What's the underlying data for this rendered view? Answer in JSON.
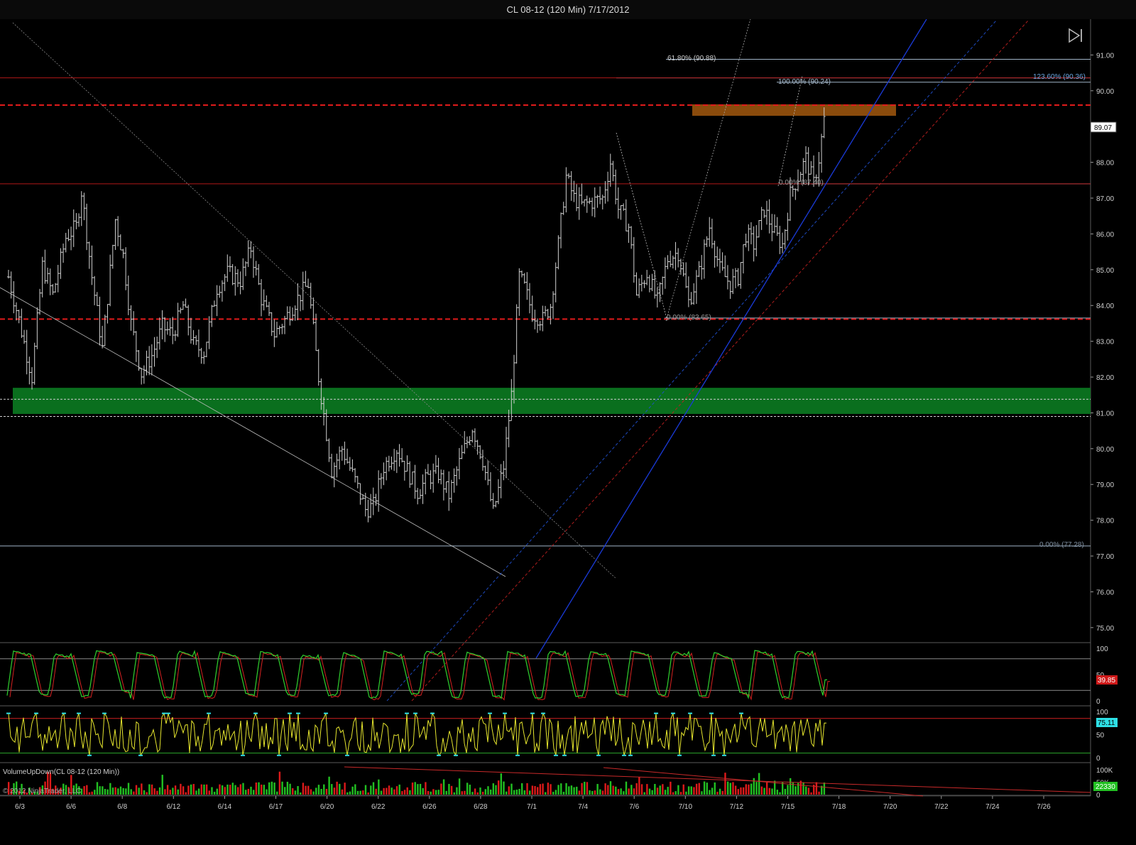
{
  "window": {
    "title": "CL 08-12 (120 Min)  7/17/2012",
    "corner_button": "F"
  },
  "colors": {
    "background": "#000000",
    "bars": "#d0d0d0",
    "support_zone": "#0a6f1e",
    "resistance_zone": "#8a4b0c",
    "red_dashed": "#e01b1b",
    "fib_line": "#a0b4c8",
    "stoch_k": "#2ed12e",
    "stoch_d": "#d62020",
    "rsi_line": "#e6e62e",
    "rsi_extreme": "#2ee0e6",
    "volume_up": "#22c022",
    "volume_down": "#dd1a1a"
  },
  "chart_data": [
    {
      "type": "ohlc",
      "instrument": "CL 08-12",
      "interval": "120 Min",
      "ylim": [
        74.6,
        92.0
      ],
      "y_ticks": [
        "91.00",
        "90.00",
        "89.00",
        "88.00",
        "87.00",
        "86.00",
        "85.00",
        "84.00",
        "83.00",
        "82.00",
        "81.00",
        "80.00",
        "79.00",
        "78.00",
        "77.00",
        "76.00",
        "75.00"
      ],
      "last_price": "89.07",
      "x_ticks": [
        "6/3",
        "6/6",
        "6/8",
        "6/12",
        "6/14",
        "6/17",
        "6/20",
        "6/22",
        "6/26",
        "6/28",
        "7/1",
        "7/4",
        "7/6",
        "7/10",
        "7/12",
        "7/15",
        "7/18",
        "7/20",
        "7/22",
        "7/24",
        "7/26"
      ],
      "close_path": [
        [
          0,
          84.8
        ],
        [
          4,
          83.6
        ],
        [
          9,
          82.0
        ],
        [
          13,
          85.1
        ],
        [
          17,
          84.3
        ],
        [
          22,
          85.9
        ],
        [
          26,
          86.2
        ],
        [
          28,
          87.2
        ],
        [
          32,
          84.8
        ],
        [
          36,
          82.8
        ],
        [
          41,
          86.4
        ],
        [
          44,
          85.4
        ],
        [
          47,
          83.5
        ],
        [
          51,
          82.1
        ],
        [
          55,
          82.6
        ],
        [
          59,
          83.4
        ],
        [
          63,
          83.2
        ],
        [
          67,
          84.0
        ],
        [
          71,
          82.9
        ],
        [
          75,
          82.7
        ],
        [
          80,
          84.5
        ],
        [
          84,
          84.9
        ],
        [
          89,
          84.7
        ],
        [
          93,
          85.6
        ],
        [
          97,
          84.2
        ],
        [
          102,
          83.2
        ],
        [
          106,
          83.6
        ],
        [
          110,
          84.1
        ],
        [
          115,
          84.6
        ],
        [
          119,
          82.0
        ],
        [
          124,
          79.4
        ],
        [
          128,
          80.0
        ],
        [
          133,
          79.1
        ],
        [
          137,
          78.3
        ],
        [
          140,
          78.4
        ],
        [
          144,
          79.5
        ],
        [
          149,
          80.0
        ],
        [
          153,
          79.4
        ],
        [
          157,
          78.8
        ],
        [
          161,
          79.2
        ],
        [
          165,
          79.3
        ],
        [
          169,
          78.7
        ],
        [
          173,
          79.6
        ],
        [
          178,
          80.6
        ],
        [
          182,
          79.7
        ],
        [
          186,
          78.2
        ],
        [
          190,
          79.5
        ],
        [
          193,
          81.5
        ],
        [
          196,
          84.8
        ],
        [
          198,
          84.5
        ],
        [
          201,
          83.8
        ],
        [
          205,
          83.6
        ],
        [
          208,
          84.0
        ],
        [
          211,
          85.7
        ],
        [
          214,
          87.6
        ],
        [
          217,
          87.0
        ],
        [
          220,
          86.8
        ],
        [
          224,
          86.9
        ],
        [
          228,
          87.0
        ],
        [
          231,
          88.0
        ],
        [
          234,
          86.7
        ],
        [
          238,
          86.2
        ],
        [
          241,
          84.3
        ],
        [
          245,
          84.9
        ],
        [
          249,
          84.1
        ],
        [
          253,
          85.3
        ],
        [
          257,
          85.5
        ],
        [
          261,
          84.1
        ],
        [
          265,
          84.9
        ],
        [
          269,
          86.2
        ],
        [
          273,
          85.0
        ],
        [
          277,
          84.6
        ],
        [
          280,
          84.8
        ],
        [
          283,
          86.0
        ],
        [
          286,
          85.7
        ],
        [
          290,
          86.7
        ],
        [
          294,
          86.0
        ],
        [
          297,
          85.7
        ],
        [
          300,
          87.1
        ],
        [
          303,
          87.6
        ],
        [
          306,
          88.1
        ],
        [
          309,
          87.4
        ],
        [
          311,
          88.1
        ],
        [
          313,
          89.2
        ]
      ],
      "levels": [
        {
          "price": 90.36,
          "label": "123.60% (90.36)",
          "style": "fib"
        },
        {
          "price": 90.24,
          "label": "100.00% (90.24)",
          "style": "fib"
        },
        {
          "price": 90.88,
          "label": "61.80% (90.88)",
          "style": "fib"
        },
        {
          "price": 87.4,
          "label": "0.00% (87.40)",
          "style": "fib"
        },
        {
          "price": 83.65,
          "label": "0.00% (83.65)",
          "style": "fib"
        },
        {
          "price": 77.28,
          "label": "0.00% (77.28)",
          "style": "fib"
        },
        {
          "price": 89.6,
          "style": "red-dashed"
        },
        {
          "price": 83.62,
          "style": "red-dashed"
        },
        {
          "price": 87.4,
          "style": "red-thin"
        },
        {
          "price": 90.36,
          "style": "red-thin"
        },
        {
          "price": 81.38,
          "style": "white-dashed"
        },
        {
          "price": 80.9,
          "style": "white-dashed"
        }
      ],
      "zones": [
        {
          "name": "support",
          "from": 80.97,
          "to": 81.7
        },
        {
          "name": "resistance",
          "from": 89.3,
          "to": 89.62
        }
      ]
    },
    {
      "type": "line",
      "indicator": "Stochastics",
      "ylim": [
        0,
        100
      ],
      "y_ticks": [
        "100",
        "50",
        "0"
      ],
      "levels": [
        80,
        20
      ],
      "last_value": "39.85",
      "cycle_peaks": [
        95,
        90,
        96,
        92,
        95,
        94,
        94,
        88,
        92,
        95,
        95,
        93,
        94,
        95,
        94,
        95,
        94,
        92,
        96,
        95
      ],
      "cycle_troughs": [
        10,
        8,
        18,
        5,
        7,
        12,
        10,
        9,
        5,
        12,
        6,
        7,
        5,
        8,
        12,
        10,
        9,
        14,
        6,
        10
      ]
    },
    {
      "type": "line",
      "indicator": "RSI",
      "ylim": [
        0,
        100
      ],
      "y_ticks": [
        "100",
        "50",
        "0"
      ],
      "levels": [
        85,
        10
      ],
      "last_value": "75.11"
    },
    {
      "type": "bar",
      "indicator": "VolumeUpDown",
      "label": "VolumeUpDown(CL 08-12 (120 Min))",
      "ylim": [
        0,
        100000
      ],
      "y_ticks": [
        "100K",
        "50K",
        "0"
      ],
      "last_value": "22330",
      "copyright": "© 2012 NinjaTrader, LLC"
    }
  ],
  "labels": {
    "fib_61": "61.80% (90.88)",
    "fib_100": "100.00% (90.24)",
    "fib_123": "123.60% (90.36)",
    "fib_0_8740": "0.00% (87.40)",
    "fib_0_8365": "0.00% (83.65)",
    "fib_0_7728": "0.00% (77.28)"
  }
}
